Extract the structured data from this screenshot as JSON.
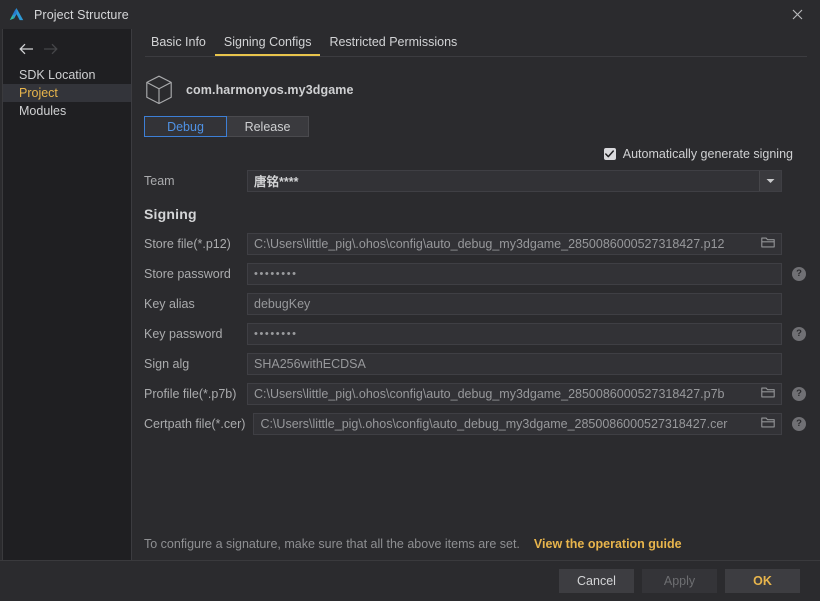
{
  "window": {
    "title": "Project Structure",
    "app_icon": "deveco-logo-icon",
    "close_icon": "close-icon"
  },
  "sidebar": {
    "back_icon": "arrow-left-icon",
    "forward_icon": "arrow-right-icon",
    "items": [
      {
        "label": "SDK Location",
        "selected": false
      },
      {
        "label": "Project",
        "selected": true
      },
      {
        "label": "Modules",
        "selected": false
      }
    ]
  },
  "tabs": [
    {
      "label": "Basic Info",
      "active": false
    },
    {
      "label": "Signing Configs",
      "active": true
    },
    {
      "label": "Restricted Permissions",
      "active": false
    }
  ],
  "package": {
    "icon": "cube-package-icon",
    "name": "com.harmonyos.my3dgame"
  },
  "build_variant": {
    "options": [
      {
        "label": "Debug",
        "active": true
      },
      {
        "label": "Release",
        "active": false
      }
    ]
  },
  "auto_signing": {
    "label": "Automatically generate signing",
    "checked": true,
    "check_icon": "check-icon"
  },
  "team": {
    "label": "Team",
    "value": "唐铭****",
    "dropdown_icon": "chevron-down-icon"
  },
  "signing": {
    "section_title": "Signing",
    "fields": [
      {
        "label": "Store file(*.p12)",
        "value": "C:\\Users\\little_pig\\.ohos\\config\\auto_debug_my3dgame_2850086000527318427.p12",
        "type": "path",
        "browse_icon": "folder-open-icon",
        "help": false
      },
      {
        "label": "Store password",
        "value": "••••••••",
        "type": "password",
        "help": true,
        "help_icon": "help-circle-icon"
      },
      {
        "label": "Key alias",
        "value": "debugKey",
        "type": "text",
        "help": false
      },
      {
        "label": "Key password",
        "value": "••••••••",
        "type": "password",
        "help": true,
        "help_icon": "help-circle-icon"
      },
      {
        "label": "Sign alg",
        "value": "SHA256withECDSA",
        "type": "text",
        "help": false
      },
      {
        "label": "Profile file(*.p7b)",
        "value": "C:\\Users\\little_pig\\.ohos\\config\\auto_debug_my3dgame_2850086000527318427.p7b",
        "type": "path",
        "browse_icon": "folder-open-icon",
        "help": true,
        "help_icon": "help-circle-icon"
      },
      {
        "label": "Certpath file(*.cer)",
        "value": "C:\\Users\\little_pig\\.ohos\\config\\auto_debug_my3dgame_2850086000527318427.cer",
        "type": "path",
        "browse_icon": "folder-open-icon",
        "help": true,
        "help_icon": "help-circle-icon"
      }
    ]
  },
  "hint": {
    "text": "To configure a signature, make sure that all the above items are set.",
    "link": "View the operation guide"
  },
  "footer": {
    "cancel": "Cancel",
    "apply": "Apply",
    "ok": "OK"
  },
  "colors": {
    "accent_yellow": "#e8b54c",
    "accent_blue": "#4f92e5",
    "bg": "#2b2b2e",
    "sidebar_bg": "#1f1f22",
    "field_bg": "#323236"
  }
}
